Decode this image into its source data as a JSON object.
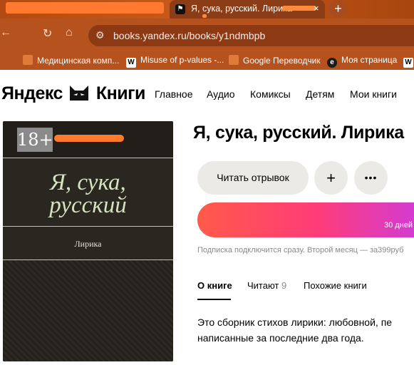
{
  "browser": {
    "active_tab_title": "Я, сука, русский. Лирика",
    "close_glyph": "×",
    "new_tab_glyph": "+",
    "url": "books.yandex.ru/books/y1ndmbpb",
    "bookmarks": [
      {
        "label": "Медицинская комп...",
        "icon": "maple-leaf-icon"
      },
      {
        "label": "Misuse of p-values -...",
        "icon": "wikipedia-icon",
        "icon_text": "W"
      },
      {
        "label": "Google Переводчик",
        "icon": "maple-leaf-icon"
      },
      {
        "label": "Моя страница",
        "icon": "e-logo-icon",
        "icon_text": "e"
      },
      {
        "label": "",
        "icon": "wikipedia-icon",
        "icon_text": "W"
      }
    ]
  },
  "site": {
    "logo_left": "Яндекс",
    "logo_right": "Книги",
    "nav": [
      "Главное",
      "Аудио",
      "Комиксы",
      "Детям",
      "Мои книги"
    ]
  },
  "cover": {
    "age": "18+",
    "title_line1": "Я, сука,",
    "title_line2": "русский",
    "subtitle": "Лирика"
  },
  "book": {
    "title": "Я, сука, русский. Лирика",
    "read_button": "Читать отрывок",
    "add_glyph": "+",
    "more_glyph": "•••",
    "cta_text": "30 дней",
    "subscription_note": "Подписка подключится сразу. Второй месяц — за399руб",
    "tabs": {
      "about": "О книге",
      "reading": "Читают",
      "reading_count": "9",
      "similar": "Похожие книги"
    },
    "description_line1": "Это сборник стихов лирики: любовной, пе",
    "description_line2": "написанные за последние два года."
  },
  "colors": {
    "tabbar": "#b44a12",
    "toolbar": "#b5521d",
    "cta_start": "#ff5a4a",
    "cta_end": "#d43bd0",
    "cover_bg": "#2a2620",
    "cover_title": "#d4e3c0"
  }
}
